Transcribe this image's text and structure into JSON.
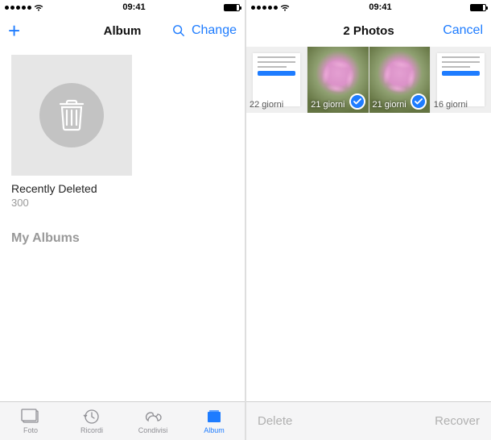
{
  "colors": {
    "accent": "#1e7cff"
  },
  "status": {
    "time": "09:41"
  },
  "left": {
    "nav": {
      "title": "Album",
      "edit": "Change"
    },
    "album": {
      "name": "Recently Deleted",
      "count": "300"
    },
    "section_my_albums": "My Albums",
    "tabs": {
      "foto": "Foto",
      "ricordi": "Ricordi",
      "condivisi": "Condivisi",
      "album": "Album"
    }
  },
  "right": {
    "nav": {
      "title": "2 Photos",
      "cancel": "Cancel"
    },
    "thumbs": [
      {
        "caption": "22 giorni",
        "selected": false,
        "kind": "doc"
      },
      {
        "caption": "21 giorni",
        "selected": true,
        "kind": "flower"
      },
      {
        "caption": "21 giorni",
        "selected": true,
        "kind": "flower"
      },
      {
        "caption": "16 giorni",
        "selected": false,
        "kind": "doc"
      }
    ],
    "toolbar": {
      "delete": "Delete",
      "recover": "Recover"
    }
  }
}
